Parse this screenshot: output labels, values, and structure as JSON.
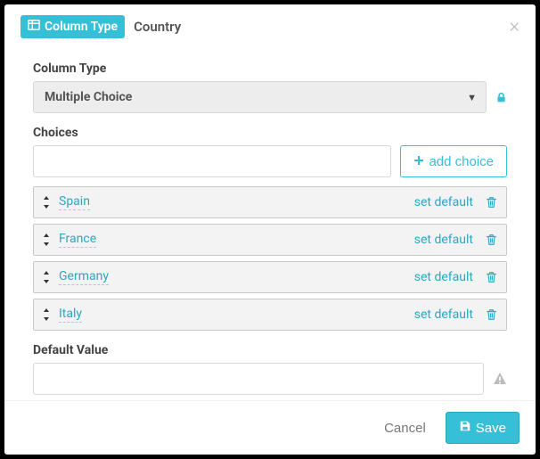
{
  "header": {
    "badge_label": "Column Type",
    "title": "Country"
  },
  "column_type": {
    "label": "Column Type",
    "selected": "Multiple Choice"
  },
  "choices": {
    "label": "Choices",
    "add_button": "add choice",
    "input_value": "",
    "set_default_label": "set default",
    "items": [
      {
        "label": "Spain"
      },
      {
        "label": "France"
      },
      {
        "label": "Germany"
      },
      {
        "label": "Italy"
      }
    ]
  },
  "default_value": {
    "label": "Default Value",
    "value": ""
  },
  "footer": {
    "cancel": "Cancel",
    "save": "Save"
  }
}
